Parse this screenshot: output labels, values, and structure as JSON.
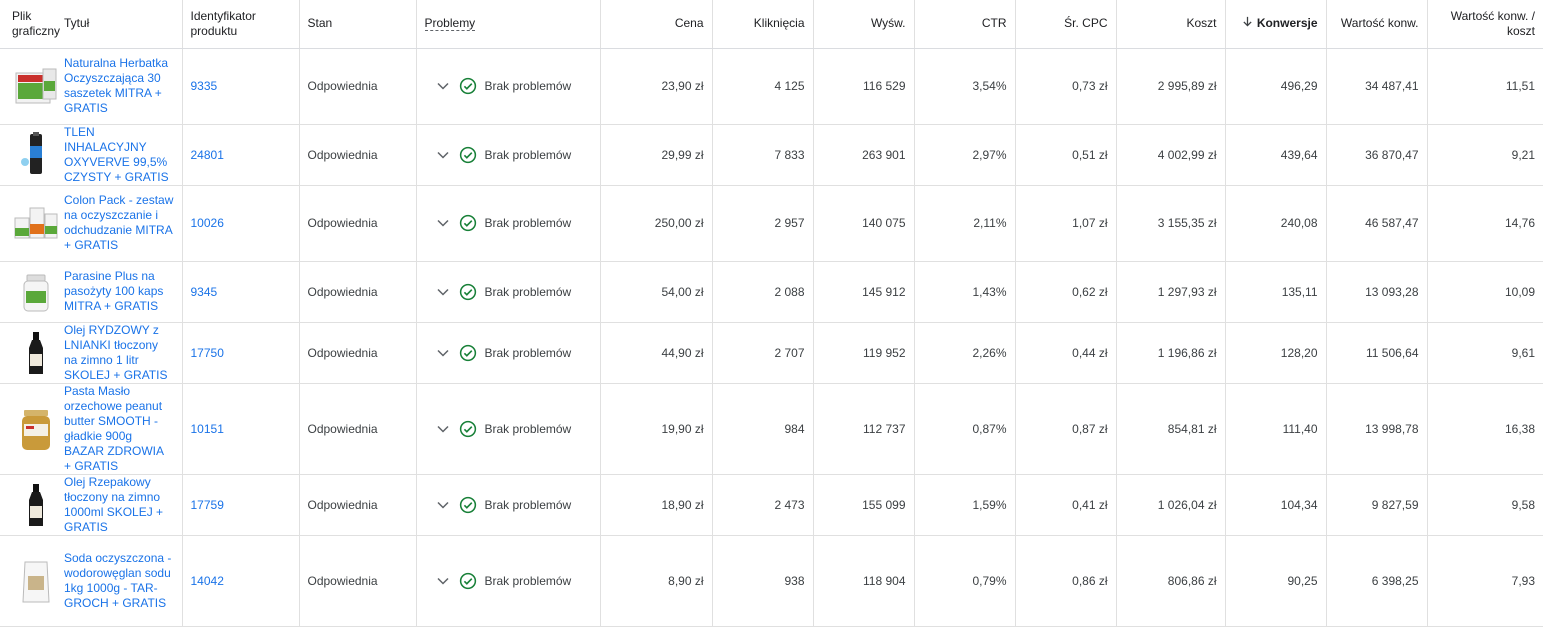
{
  "headers": {
    "image": "Plik graficzny",
    "title": "Tytuł",
    "id": "Identyfikator produktu",
    "status": "Stan",
    "problems": "Problemy",
    "price": "Cena",
    "clicks": "Kliknięcia",
    "impressions": "Wyśw.",
    "ctr": "CTR",
    "cpc": "Śr. CPC",
    "cost": "Koszt",
    "conversions": "Konwersje",
    "conv_value": "Wartość konw.",
    "conv_value_cost": "Wartość konw. / koszt"
  },
  "rows": [
    {
      "title": "Naturalna Herbatka Oczyszczająca 30 saszetek MITRA + GRATIS",
      "id": "9335",
      "status": "Odpowiednia",
      "problems": "Brak problemów",
      "price": "23,90 zł",
      "clicks": "4 125",
      "impressions": "116 529",
      "ctr": "3,54%",
      "cpc": "0,73 zł",
      "cost": "2 995,89 zł",
      "conversions": "496,29",
      "conv_value": "34 487,41",
      "conv_value_cost": "11,51",
      "thumb": "box-green"
    },
    {
      "title": "TLEN INHALACYJNY OXYVERVE 99,5% CZYSTY + GRATIS",
      "id": "24801",
      "status": "Odpowiednia",
      "problems": "Brak problemów",
      "price": "29,99 zł",
      "clicks": "7 833",
      "impressions": "263 901",
      "ctr": "2,97%",
      "cpc": "0,51 zł",
      "cost": "4 002,99 zł",
      "conversions": "439,64",
      "conv_value": "36 870,47",
      "conv_value_cost": "9,21",
      "thumb": "can-dark"
    },
    {
      "title": "Colon Pack - zestaw na oczyszczanie i odchudzanie MITRA + GRATIS",
      "id": "10026",
      "status": "Odpowiednia",
      "problems": "Brak problemów",
      "price": "250,00 zł",
      "clicks": "2 957",
      "impressions": "140 075",
      "ctr": "2,11%",
      "cpc": "1,07 zł",
      "cost": "3 155,35 zł",
      "conversions": "240,08",
      "conv_value": "46 587,47",
      "conv_value_cost": "14,76",
      "thumb": "pack"
    },
    {
      "title": "Parasine Plus na pasożyty 100 kaps MITRA + GRATIS",
      "id": "9345",
      "status": "Odpowiednia",
      "problems": "Brak problemów",
      "price": "54,00 zł",
      "clicks": "2 088",
      "impressions": "145 912",
      "ctr": "1,43%",
      "cpc": "0,62 zł",
      "cost": "1 297,93 zł",
      "conversions": "135,11",
      "conv_value": "13 093,28",
      "conv_value_cost": "10,09",
      "thumb": "jar-white"
    },
    {
      "title": "Olej RYDZOWY z LNIANKI tłoczony na zimno 1 litr SKOLEJ + GRATIS",
      "id": "17750",
      "status": "Odpowiednia",
      "problems": "Brak problemów",
      "price": "44,90 zł",
      "clicks": "2 707",
      "impressions": "119 952",
      "ctr": "2,26%",
      "cpc": "0,44 zł",
      "cost": "1 196,86 zł",
      "conversions": "128,20",
      "conv_value": "11 506,64",
      "conv_value_cost": "9,61",
      "thumb": "bottle-dark"
    },
    {
      "title": "Pasta Masło orzechowe peanut butter SMOOTH - gładkie 900g BAZAR ZDROWIA + GRATIS",
      "id": "10151",
      "status": "Odpowiednia",
      "problems": "Brak problemów",
      "price": "19,90 zł",
      "clicks": "984",
      "impressions": "112 737",
      "ctr": "0,87%",
      "cpc": "0,87 zł",
      "cost": "854,81 zł",
      "conversions": "111,40",
      "conv_value": "13 998,78",
      "conv_value_cost": "16,38",
      "thumb": "jar-peanut"
    },
    {
      "title": "Olej Rzepakowy tłoczony na zimno 1000ml SKOLEJ + GRATIS",
      "id": "17759",
      "status": "Odpowiednia",
      "problems": "Brak problemów",
      "price": "18,90 zł",
      "clicks": "2 473",
      "impressions": "155 099",
      "ctr": "1,59%",
      "cpc": "0,41 zł",
      "cost": "1 026,04 zł",
      "conversions": "104,34",
      "conv_value": "9 827,59",
      "conv_value_cost": "9,58",
      "thumb": "bottle-dark"
    },
    {
      "title": "Soda oczyszczona - wodorowęglan sodu 1kg 1000g - TAR-GROCH + GRATIS",
      "id": "14042",
      "status": "Odpowiednia",
      "problems": "Brak problemów",
      "price": "8,90 zł",
      "clicks": "938",
      "impressions": "118 904",
      "ctr": "0,79%",
      "cpc": "0,86 zł",
      "cost": "806,86 zł",
      "conversions": "90,25",
      "conv_value": "6 398,25",
      "conv_value_cost": "7,93",
      "thumb": "bag"
    }
  ],
  "row_heights": [
    76,
    61,
    76,
    61,
    61,
    91,
    61,
    91
  ],
  "colors": {
    "link": "#1a73e8",
    "ok": "#188038",
    "border": "#e0e0e0"
  },
  "icons": {
    "ok": "check-circle-icon",
    "expand": "chevron-down-icon",
    "sort": "arrow-down-icon"
  }
}
